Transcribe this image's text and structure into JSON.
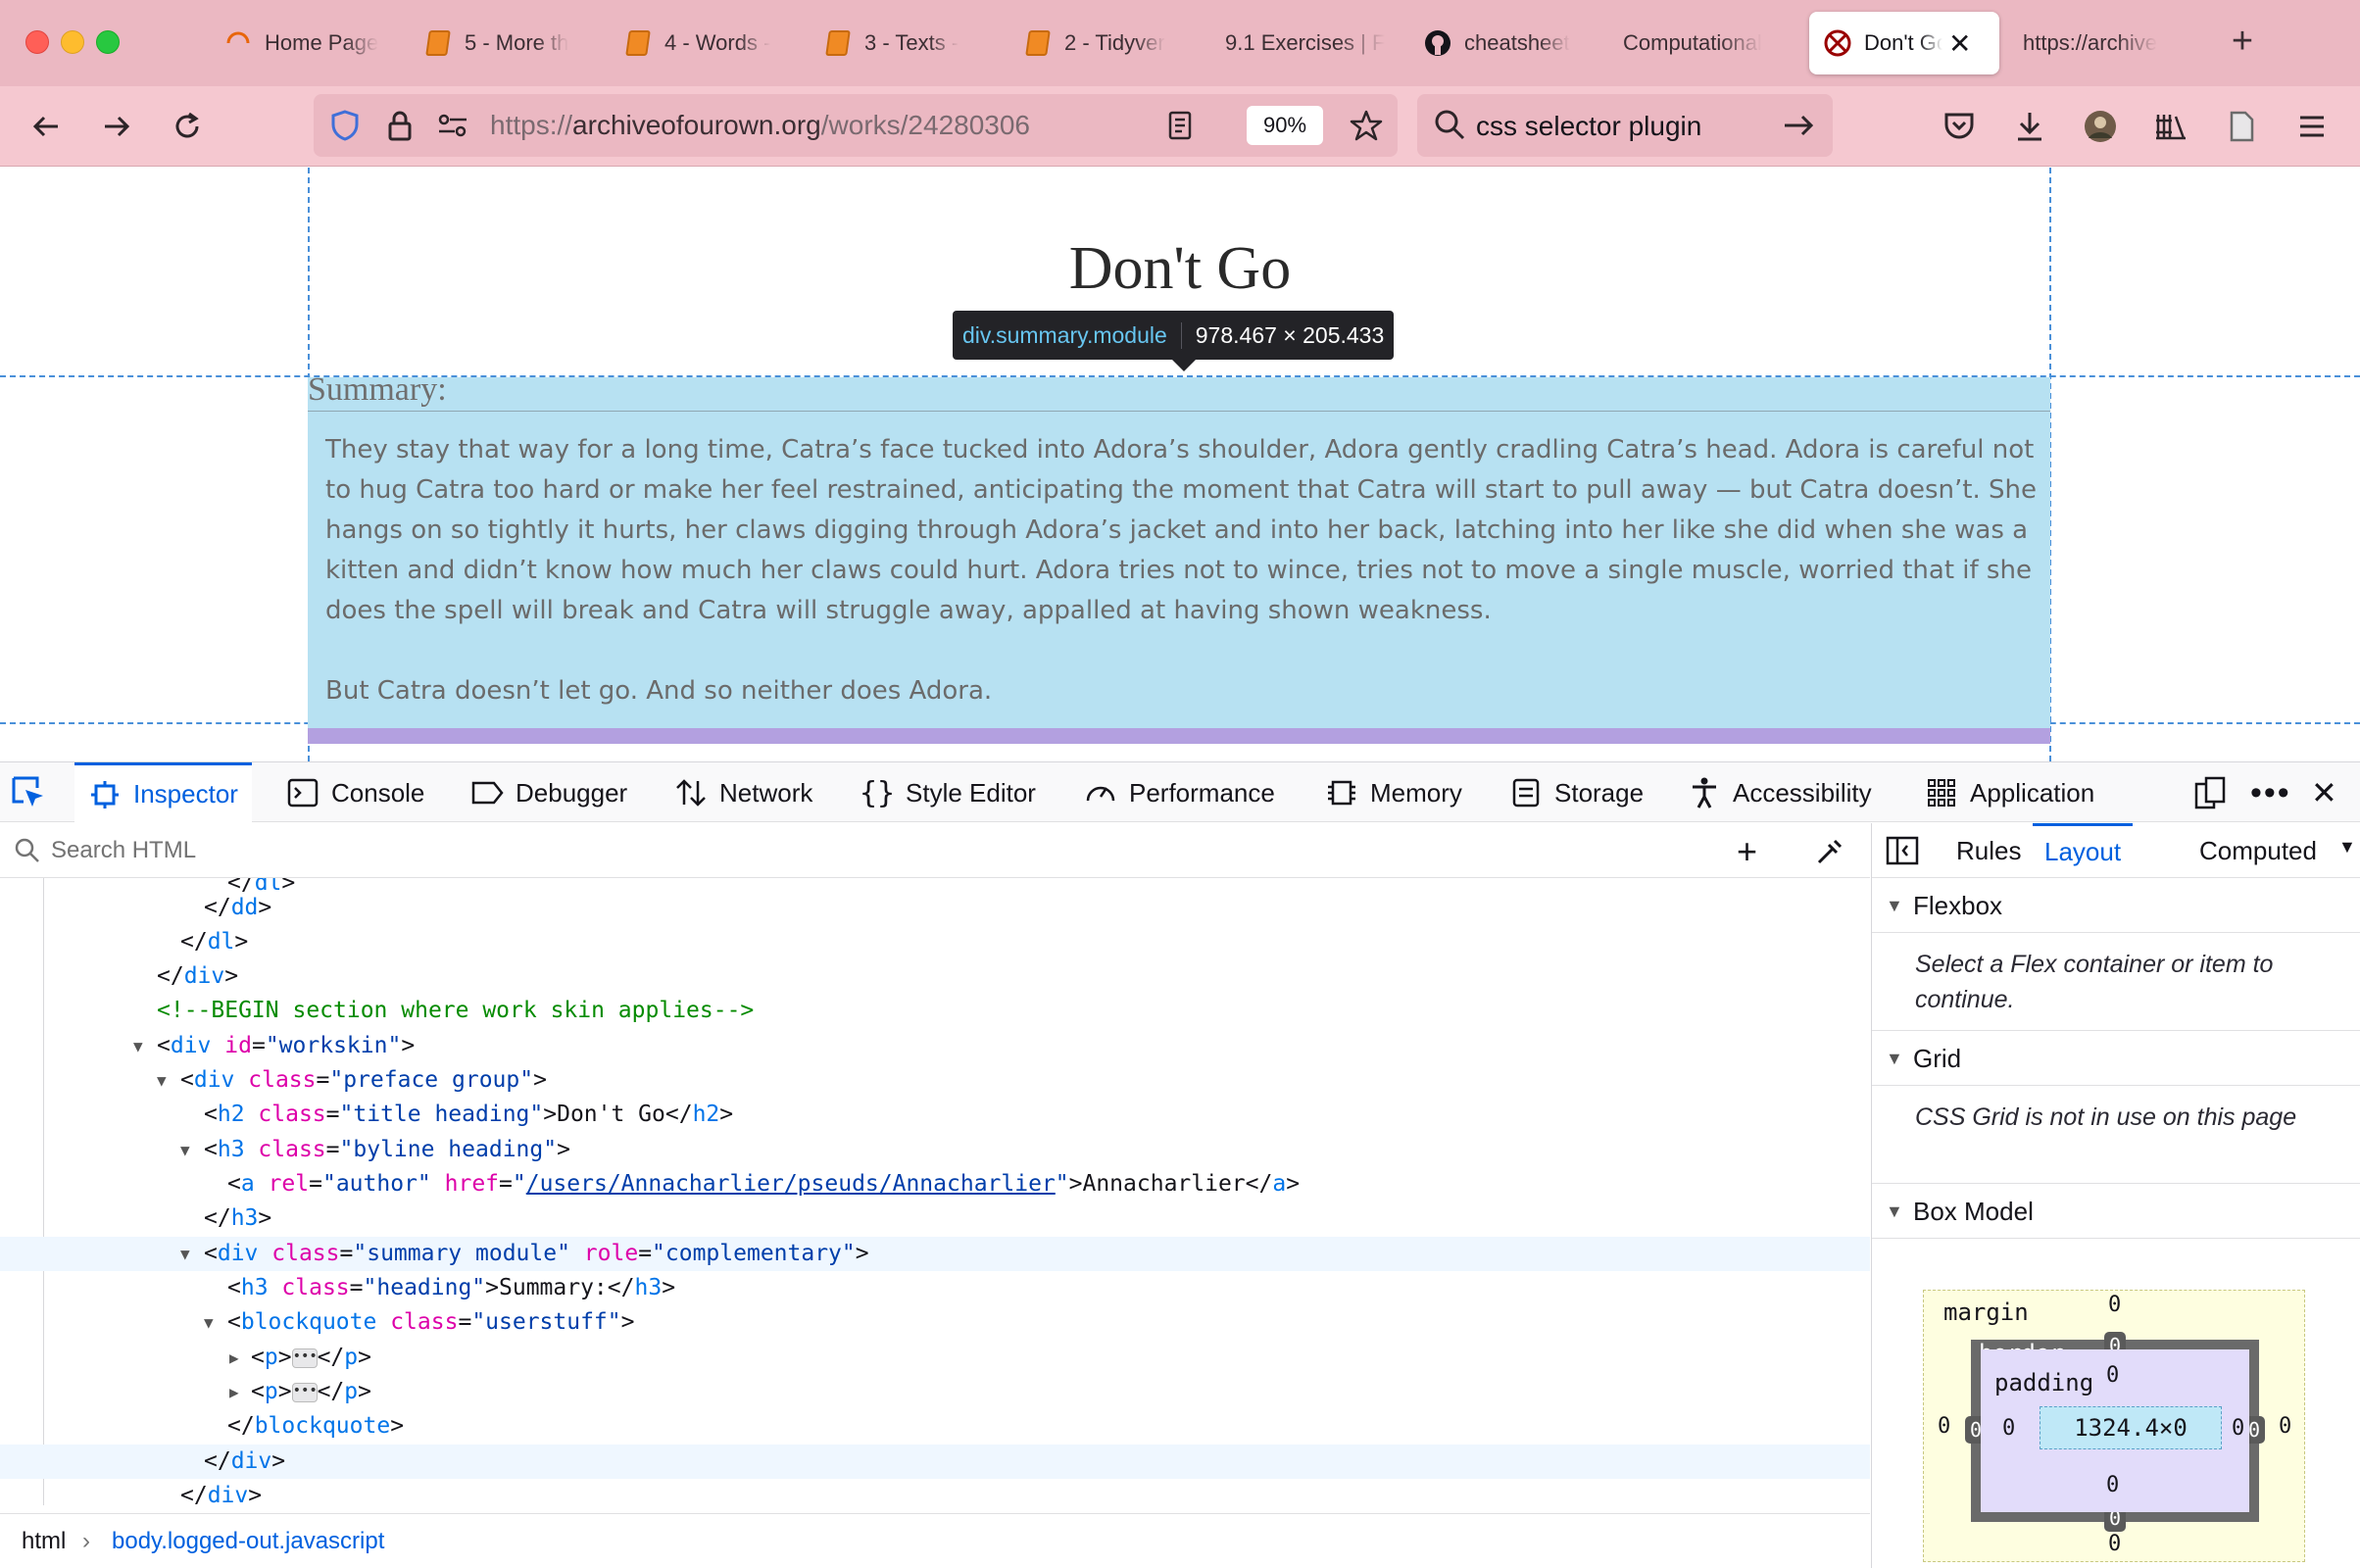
{
  "browser": {
    "tabs": [
      {
        "label": "Home Page",
        "icon": "loading-spinner-icon"
      },
      {
        "label": "5 - More th",
        "icon": "book-icon"
      },
      {
        "label": "4 - Words -",
        "icon": "book-icon"
      },
      {
        "label": "3 - Texts -",
        "icon": "book-icon"
      },
      {
        "label": "2 - Tidyver",
        "icon": "book-icon"
      },
      {
        "label": "9.1 Exercises | F",
        "icon": "none"
      },
      {
        "label": "cheatsheet",
        "icon": "github-icon"
      },
      {
        "label": "Computational",
        "icon": "none"
      },
      {
        "label": "Don't Go",
        "icon": "ao3-icon"
      },
      {
        "label": "https://archive",
        "icon": "none"
      }
    ],
    "active_tab_index": 8,
    "url": {
      "scheme": "https://",
      "host": "archiveofourown.org",
      "path": "/works/24280306"
    },
    "zoom": "90%",
    "search": "css selector plugin",
    "colors": {
      "tabstrip": "#ebb8c2",
      "navbar": "#f5c8d0"
    }
  },
  "page": {
    "title": "Don't Go",
    "summary_heading": "Summary:",
    "summary_paragraphs": [
      "They stay that way for a long time, Catra’s face tucked into Adora’s shoulder, Adora gently cradling Catra’s head. Adora is careful not to hug Catra too hard or make her feel restrained, anticipating the moment that Catra will start to pull away — but Catra doesn’t. She hangs on so tightly it hurts, her claws digging through Adora’s jacket and into her back, latching into her like she did when she was a kitten and didn’t know how much her claws could hurt. Adora tries not to wince, tries not to move a single muscle, worried that if she does the spell will break and Catra will struggle away, appalled at having shown weakness.",
      "But Catra doesn’t let go. And so neither does Adora."
    ]
  },
  "tooltip": {
    "selector": "div.summary.module",
    "size": "978.467 × 205.433"
  },
  "devtools": {
    "tabs": [
      "Inspector",
      "Console",
      "Debugger",
      "Network",
      "Style Editor",
      "Performance",
      "Memory",
      "Storage",
      "Accessibility",
      "Application"
    ],
    "active_tab": "Inspector",
    "search_placeholder": "Search HTML",
    "breadcrumbs": [
      "html",
      "body.logged-out.javascript"
    ],
    "side_tabs": [
      "Rules",
      "Layout",
      "Computed"
    ],
    "active_side_tab": "Layout",
    "flexbox": {
      "title": "Flexbox",
      "message": "Select a Flex container or item to continue."
    },
    "grid": {
      "title": "Grid",
      "message": "CSS Grid is not in use on this page"
    },
    "box_model": {
      "title": "Box Model",
      "margin_label": "margin",
      "border_label": "border",
      "padding_label": "padding",
      "content_size": "1324.4×0",
      "values": {
        "margin": [
          0,
          0,
          0,
          0
        ],
        "border": [
          0,
          0,
          0,
          0
        ],
        "padding": [
          0,
          0,
          0,
          0
        ]
      }
    }
  }
}
